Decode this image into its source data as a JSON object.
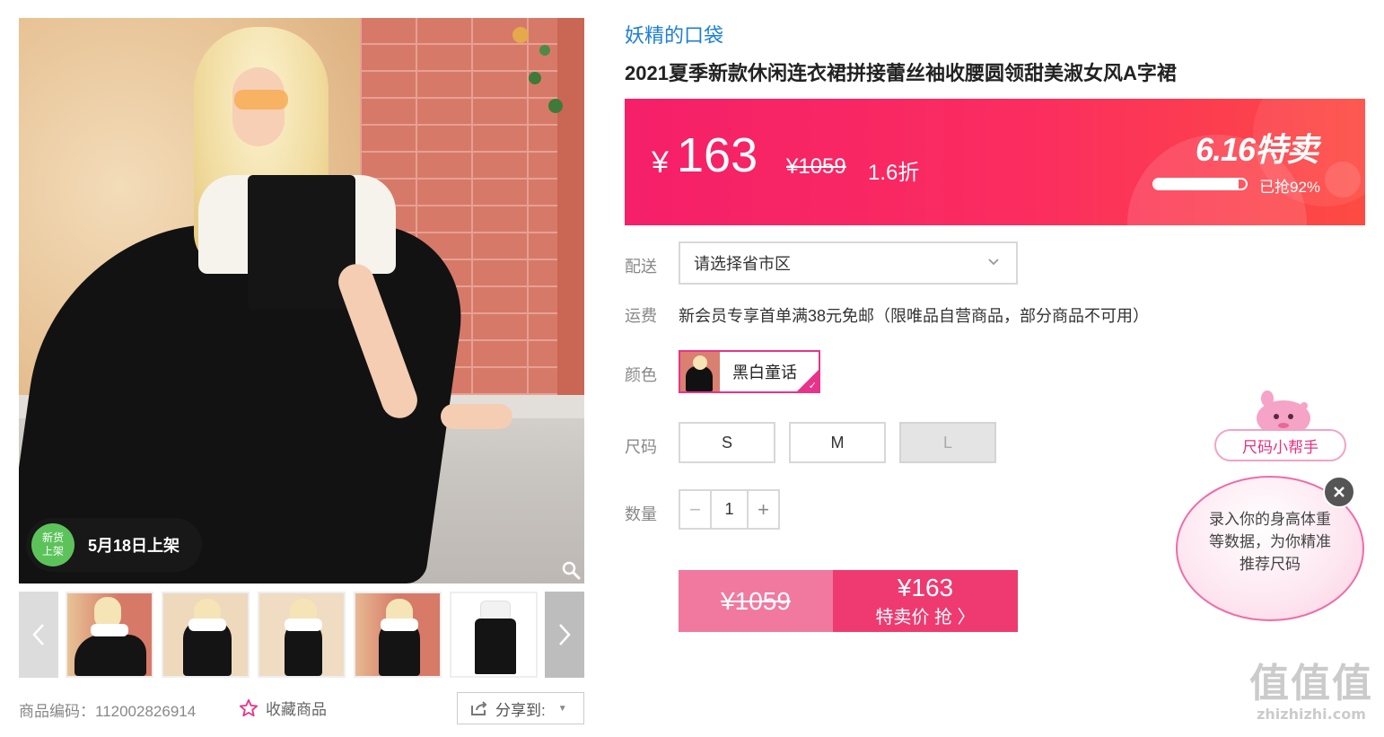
{
  "gallery": {
    "new_badge_circle": "新货\n上架",
    "new_badge_text": "5月18日上架",
    "thumbnails": [
      "thumb-1",
      "thumb-2",
      "thumb-3",
      "thumb-4",
      "thumb-5"
    ],
    "sku_code": "商品编码：112002826914",
    "favorite_label": "收藏商品",
    "share_label": "分享到:"
  },
  "product": {
    "store_name": "妖精的口袋",
    "title": "2021夏季新款休闲连衣裙拼接蕾丝袖收腰圆领甜美淑女风A字裙"
  },
  "price": {
    "currency": "¥",
    "current": "163",
    "original": "¥1059",
    "discount": "1.6折",
    "sale_label": "6.16特卖",
    "sold_percent": 0.92,
    "sold_text": "已抢92%"
  },
  "delivery": {
    "label": "配送",
    "placeholder": "请选择省市区"
  },
  "shipping": {
    "label": "运费",
    "text": "新会员专享首单满38元免邮（限唯品自营商品，部分商品不可用）"
  },
  "color": {
    "label": "颜色",
    "selected": "黑白童话"
  },
  "size": {
    "label": "尺码",
    "options": [
      "S",
      "M",
      "L"
    ]
  },
  "quantity": {
    "label": "数量",
    "minus": "−",
    "value": "1",
    "plus": "+"
  },
  "buy": {
    "original": "¥1059",
    "price": "¥163",
    "action": "特卖价 抢 〉"
  },
  "helper": {
    "tag": "尺码小帮手",
    "text": "录入你的身高体重等数据，为你精准推荐尺码"
  },
  "watermark": {
    "big": "值值值",
    "small": "zhizhizhi.com"
  },
  "colors": {
    "accent": "#ee3a71",
    "store_link": "#1d7fd6",
    "banner_start": "#f51f6a",
    "banner_end": "#fd4b42"
  }
}
